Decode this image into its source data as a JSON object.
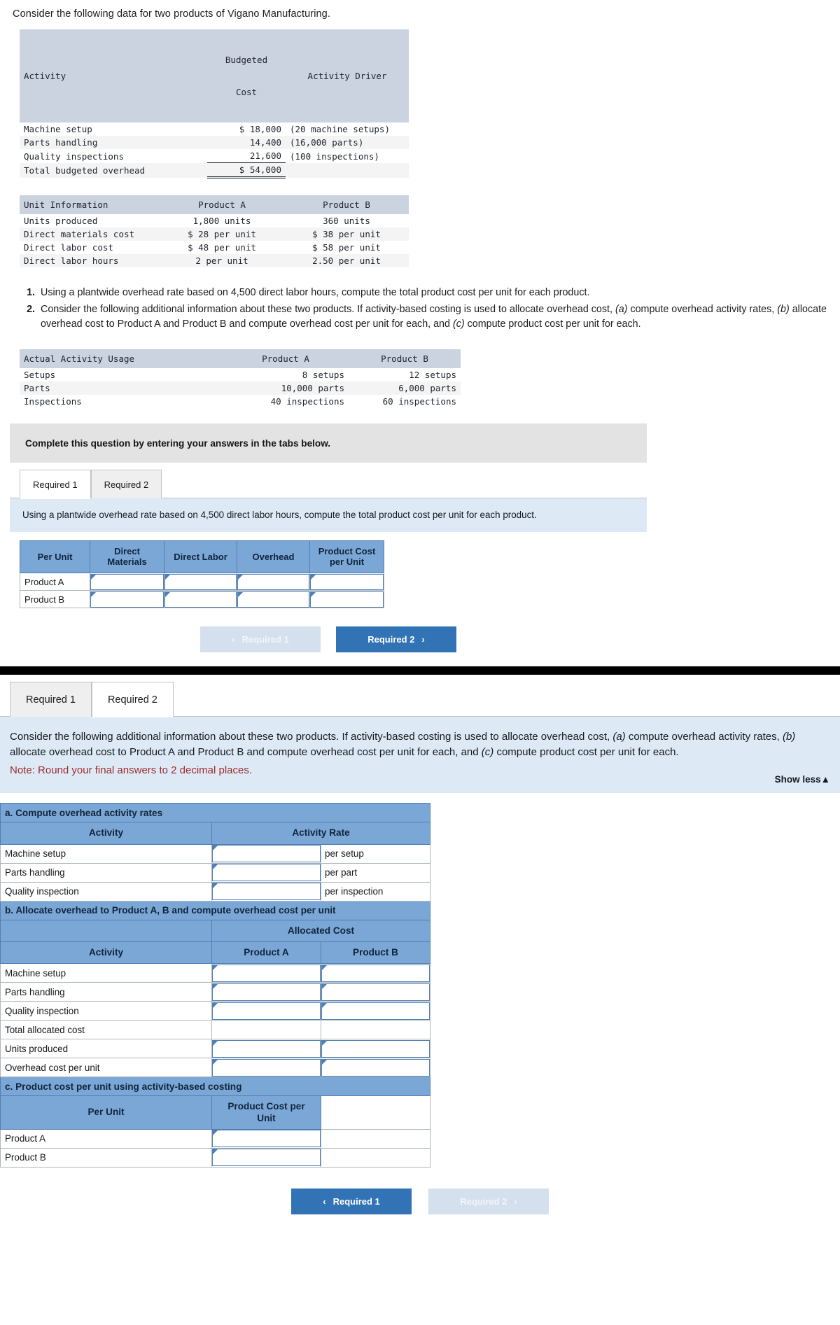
{
  "intro": "Consider the following data for two products of Vigano Manufacturing.",
  "activity_table": {
    "headers": [
      "Activity",
      "Budgeted\nCost",
      "Activity Driver"
    ],
    "header_col1": "Activity",
    "header_col2_line1": "Budgeted",
    "header_col2_line2": "Cost",
    "header_col3": "Activity Driver",
    "rows": [
      {
        "activity": "Machine setup",
        "cost": "$ 18,000",
        "driver": "(20 machine setups)"
      },
      {
        "activity": "Parts handling",
        "cost": "14,400",
        "driver": "(16,000 parts)"
      },
      {
        "activity": "Quality inspections",
        "cost": "21,600",
        "driver": "(100 inspections)"
      }
    ],
    "total_label": "Total budgeted overhead",
    "total_cost": "$ 54,000"
  },
  "unit_info_table": {
    "header_col1": "Unit Information",
    "header_col2": "Product A",
    "header_col3": "Product B",
    "rows": [
      {
        "label": "Units produced",
        "a": "1,800 units",
        "b": "360 units"
      },
      {
        "label": "Direct materials cost",
        "a": "$ 28 per unit",
        "b": "$ 38 per unit"
      },
      {
        "label": "Direct labor cost",
        "a": "$ 48 per unit",
        "b": "$ 58 per unit"
      },
      {
        "label": "Direct labor hours",
        "a": "2 per unit",
        "b": "2.50 per unit"
      }
    ]
  },
  "requirements": {
    "item1": "Using a plantwide overhead rate based on 4,500 direct labor hours, compute the total product cost per unit for each product.",
    "item2_part1": "Consider the following additional information about these two products. If activity-based costing is used to allocate overhead cost,",
    "item2_a": "(a)",
    "item2_part2": "compute overhead activity rates,",
    "item2_b": "(b)",
    "item2_part3": "allocate overhead cost to Product A and Product B and compute overhead cost per unit for each, and",
    "item2_c": "(c)",
    "item2_part4": "compute product cost per unit for each."
  },
  "usage_table": {
    "header_col1": "Actual Activity Usage",
    "header_col2": "Product A",
    "header_col3": "Product B",
    "rows": [
      {
        "label": "Setups",
        "a": "8 setups",
        "b": "12 setups"
      },
      {
        "label": "Parts",
        "a": "10,000 parts",
        "b": "6,000 parts"
      },
      {
        "label": "Inspections",
        "a": "40 inspections",
        "b": "60 inspections"
      }
    ]
  },
  "banner": "Complete this question by entering your answers in the tabs below.",
  "tabs": {
    "required1": "Required 1",
    "required2": "Required 2"
  },
  "req1": {
    "instruction": "Using a plantwide overhead rate based on 4,500 direct labor hours, compute the total product cost per unit for each product.",
    "headers": {
      "per_unit": "Per Unit",
      "direct_materials_l1": "Direct",
      "direct_materials_l2": "Materials",
      "direct_labor": "Direct Labor",
      "overhead": "Overhead",
      "product_cost_l1": "Product Cost",
      "product_cost_l2": "per Unit"
    },
    "rows": [
      {
        "label": "Product A",
        "direct_materials": "",
        "direct_labor": "",
        "overhead": "",
        "product_cost": ""
      },
      {
        "label": "Product B",
        "direct_materials": "",
        "direct_labor": "",
        "overhead": "",
        "product_cost": ""
      }
    ],
    "nav_prev": "Required 1",
    "nav_next": "Required 2"
  },
  "req2": {
    "instruction_p1": "Consider the following additional information about these two products. If activity-based costing is used to allocate overhead cost,",
    "instruction_a": "(a)",
    "instruction_p2": "compute overhead activity rates,",
    "instruction_b": "(b)",
    "instruction_p3": "allocate overhead cost to Product A and Product B and compute overhead cost per unit for each, and",
    "instruction_c": "(c)",
    "instruction_p4": "compute product cost per unit for each.",
    "note": "Note: Round your final answers to 2 decimal places.",
    "show_less": "Show less",
    "show_less_icon": "caret-up-icon",
    "section_a": {
      "title": "a. Compute overhead activity rates",
      "header_activity": "Activity",
      "header_rate": "Activity Rate",
      "rows": [
        {
          "activity": "Machine setup",
          "rate": "",
          "unit": "per setup"
        },
        {
          "activity": "Parts handling",
          "rate": "",
          "unit": "per part"
        },
        {
          "activity": "Quality inspection",
          "rate": "",
          "unit": "per inspection"
        }
      ]
    },
    "section_b": {
      "title": "b. Allocate overhead to Product A, B and compute overhead cost per unit",
      "header_allocated": "Allocated Cost",
      "header_activity": "Activity",
      "header_product_a": "Product A",
      "header_product_b": "Product B",
      "rows": [
        {
          "activity": "Machine setup",
          "input": true
        },
        {
          "activity": "Parts handling",
          "input": true
        },
        {
          "activity": "Quality inspection",
          "input": true
        },
        {
          "activity": "Total allocated cost",
          "input": false
        },
        {
          "activity": "Units produced",
          "input": true
        },
        {
          "activity": "Overhead cost per unit",
          "input": true
        }
      ]
    },
    "section_c": {
      "title": "c. Product cost per unit using activity-based costing",
      "header_per_unit": "Per Unit",
      "header_cost_l1": "Product Cost per",
      "header_cost_l2": "Unit",
      "rows": [
        {
          "label": "Product A"
        },
        {
          "label": "Product B"
        }
      ]
    },
    "nav_prev": "Required 1",
    "nav_next": "Required 2"
  }
}
